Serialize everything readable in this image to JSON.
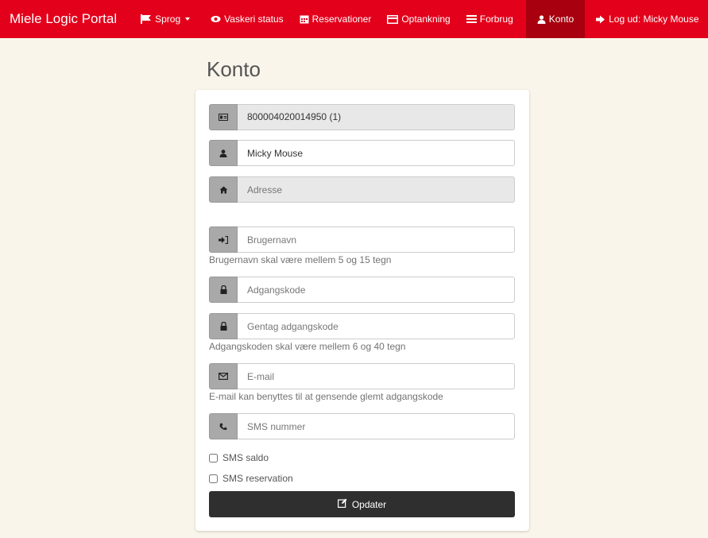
{
  "nav": {
    "brand": "Miele Logic Portal",
    "items": [
      {
        "label": "Sprog",
        "icon": "flag-icon"
      },
      {
        "label": "Vaskeri status",
        "icon": "eye-icon"
      },
      {
        "label": "Reservationer",
        "icon": "calendar-icon"
      },
      {
        "label": "Optankning",
        "icon": "credit-card-icon"
      },
      {
        "label": "Forbrug",
        "icon": "list-icon"
      },
      {
        "label": "Konto",
        "icon": "user-icon"
      },
      {
        "label": "Log ud: Micky Mouse",
        "icon": "logout-icon"
      }
    ],
    "active": "Konto"
  },
  "page": {
    "title": "Konto"
  },
  "form": {
    "card_number": "800004020014950 (1)",
    "name": "Micky Mouse",
    "address_placeholder": "Adresse",
    "username_placeholder": "Brugernavn",
    "username_help": "Brugernavn skal være mellem 5 og 15 tegn",
    "password_placeholder": "Adgangskode",
    "password_repeat_placeholder": "Gentag adgangskode",
    "password_help": "Adgangskoden skal være mellem 6 og 40 tegn",
    "email_placeholder": "E-mail",
    "email_help": "E-mail kan benyttes til at gensende glemt adgangskode",
    "sms_placeholder": "SMS nummer",
    "sms_saldo_label": "SMS saldo",
    "sms_reservation_label": "SMS reservation",
    "submit_label": "Opdater"
  },
  "colors": {
    "brand_red": "#e3001b",
    "active_red": "#a8000e",
    "button_dark": "#2f2f2f",
    "background": "#faf5ea"
  }
}
